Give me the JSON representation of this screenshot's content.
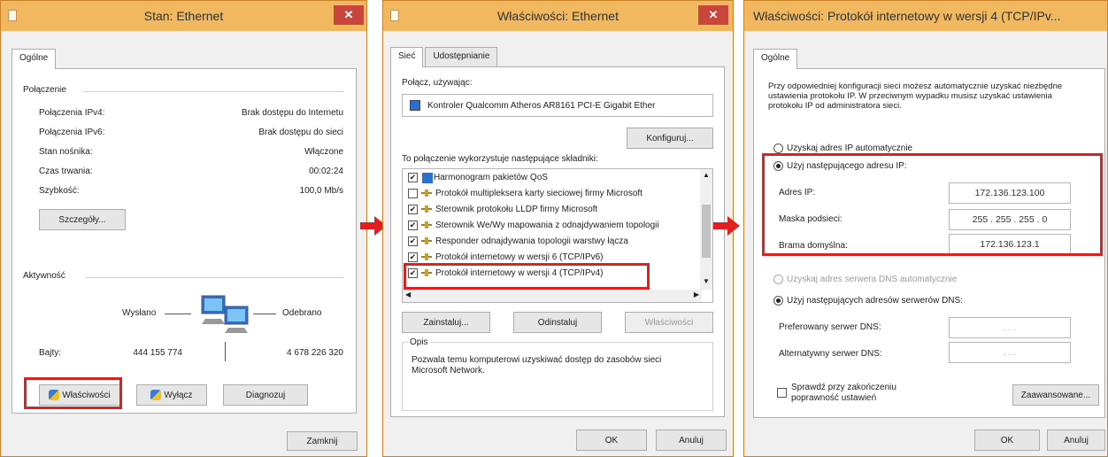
{
  "w1": {
    "title": "Stan: Ethernet",
    "close": "✕",
    "tab": "Ogólne",
    "conn_header": "Połączenie",
    "rows": [
      {
        "label": "Połączenia IPv4:",
        "value": "Brak dostępu do Internetu"
      },
      {
        "label": "Połączenia IPv6:",
        "value": "Brak dostępu do sieci"
      },
      {
        "label": "Stan nośnika:",
        "value": "Włączone"
      },
      {
        "label": "Czas trwania:",
        "value": "00:02:24"
      },
      {
        "label": "Szybkość:",
        "value": "100,0 Mb/s"
      }
    ],
    "details_btn": "Szczegóły...",
    "activity_header": "Aktywność",
    "sent_label": "Wysłano",
    "recv_label": "Odebrano",
    "bytes_label": "Bajty:",
    "bytes_sent": "444 155 774",
    "bytes_recv": "4 678 226 320",
    "props_btn": "Właściwości",
    "disable_btn": "Wyłącz",
    "diagnose_btn": "Diagnozuj",
    "close_btn": "Zamknij"
  },
  "w2": {
    "title": "Właściwości: Ethernet",
    "close": "✕",
    "tab1": "Sieć",
    "tab2": "Udostępnianie",
    "connect_using": "Połącz, używając:",
    "adapter": "Kontroler Qualcomm Atheros AR8161 PCI-E Gigabit Ether",
    "configure_btn": "Konfiguruj...",
    "components_label": "To połączenie wykorzystuje następujące składniki:",
    "items": [
      {
        "check": "✔",
        "label": "Harmonogram pakietów QoS"
      },
      {
        "check": "",
        "label": "Protokół multipleksera karty sieciowej firmy Microsoft"
      },
      {
        "check": "✔",
        "label": "Sterownik protokołu LLDP firmy Microsoft"
      },
      {
        "check": "✔",
        "label": "Sterownik We/Wy mapowania z odnajdywaniem topologii"
      },
      {
        "check": "✔",
        "label": "Responder odnajdywania topologii warstwy łącza"
      },
      {
        "check": "✔",
        "label": "Protokół internetowy w wersji 6 (TCP/IPv6)"
      },
      {
        "check": "✔",
        "label": "Protokół internetowy w wersji 4 (TCP/IPv4)"
      }
    ],
    "install_btn": "Zainstaluj...",
    "uninstall_btn": "Odinstaluj",
    "props_btn": "Właściwości",
    "desc_header": "Opis",
    "desc_text": "Pozwala temu komputerowi uzyskiwać dostęp do zasobów sieci Microsoft Network.",
    "ok_btn": "OK",
    "cancel_btn": "Anuluj"
  },
  "w3": {
    "title": "Właściwości: Protokół internetowy w wersji 4 (TCP/IPv...",
    "tab": "Ogólne",
    "intro": "Przy odpowiedniej konfiguracji sieci możesz automatycznie uzyskać niezbędne ustawienia protokołu IP. W przeciwnym wypadku musisz uzyskać ustawienia protokołu IP od administratora sieci.",
    "auto_ip": "Uzyskaj adres IP automatycznie",
    "manual_ip": "Użyj następującego adresu IP:",
    "ip_label": "Adres IP:",
    "ip_value": "172.136.123.100",
    "mask_label": "Maska podsieci:",
    "mask_value": "255 . 255 . 255 .  0",
    "gw_label": "Brama domyślna:",
    "gw_value": "172.136.123.1",
    "auto_dns": "Uzyskaj adres serwera DNS automatycznie",
    "manual_dns": "Użyj następujących adresów serwerów DNS:",
    "pref_dns_label": "Preferowany serwer DNS:",
    "alt_dns_label": "Alternatywny serwer DNS:",
    "dns_dots": ".      .      .",
    "validate": "Sprawdź przy zakończeniu poprawność ustawień",
    "advanced_btn": "Zaawansowane...",
    "ok_btn": "OK",
    "cancel_btn": "Anuluj"
  },
  "colors": {
    "titlebar": "#f2b85f",
    "highlight": "#e02020",
    "close": "#c9463d"
  }
}
